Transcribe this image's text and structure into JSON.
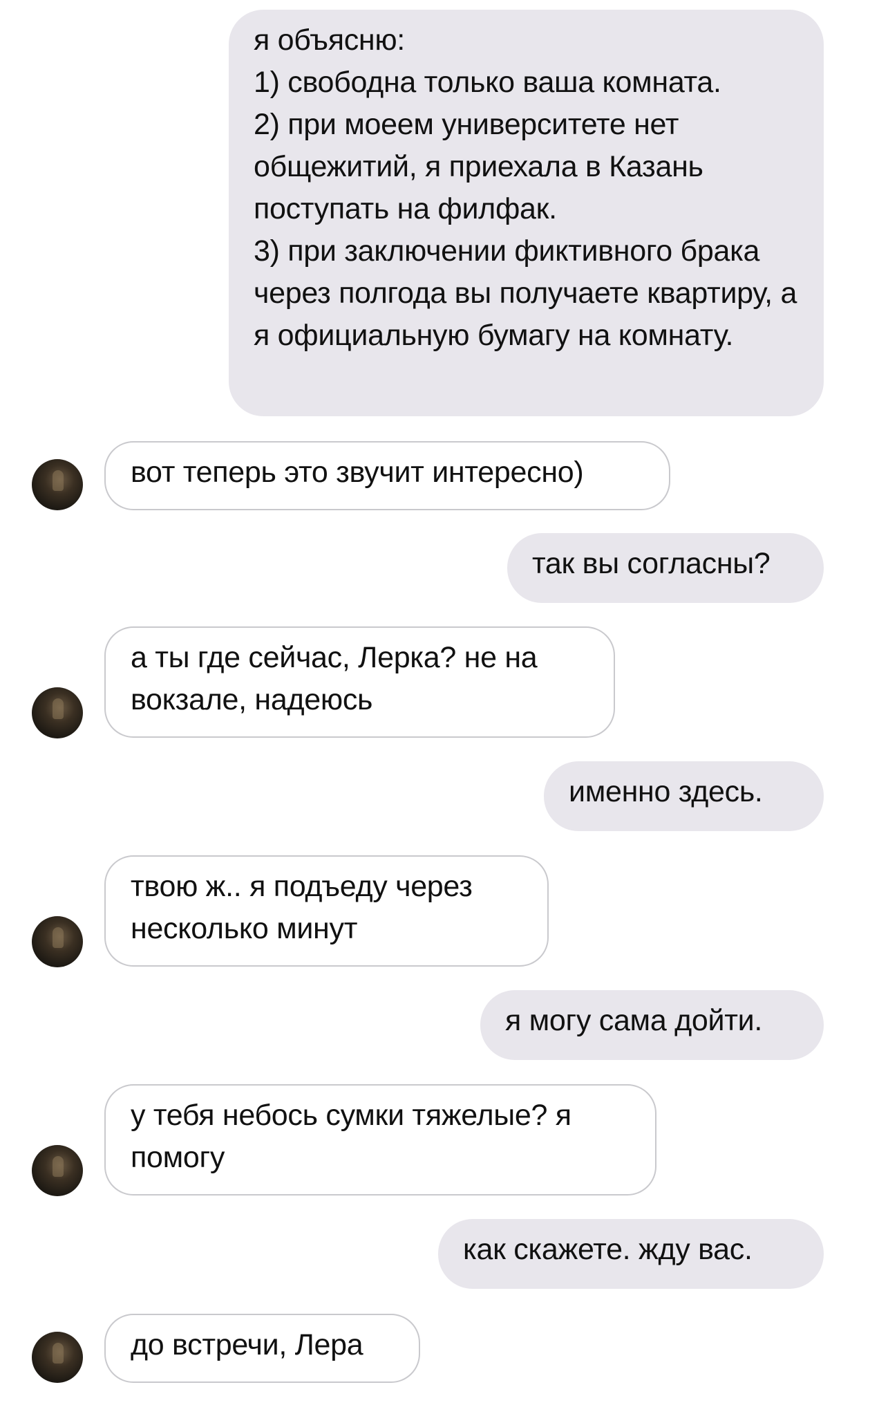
{
  "messages": [
    {
      "id": "m1",
      "side": "sent",
      "text": "я объясню:\n1) свободна только ваша комната.\n2) при моеем университете нет общежитий, я приехала в Казань поступать на филфак.\n3) при заключении фиктивного брака через полгода вы получаете квартиру, а я официальную бумагу на комнату."
    },
    {
      "id": "m2",
      "side": "received",
      "text": "вот теперь это звучит интересно)"
    },
    {
      "id": "m3",
      "side": "sent",
      "text": "так вы согласны?"
    },
    {
      "id": "m4",
      "side": "received",
      "text": "а ты где сейчас, Лерка? не на вокзале, надеюсь"
    },
    {
      "id": "m5",
      "side": "sent",
      "text": "именно здесь."
    },
    {
      "id": "m6",
      "side": "received",
      "text": "твою ж.. я подъеду через несколько минут"
    },
    {
      "id": "m7",
      "side": "sent",
      "text": "я могу сама дойти."
    },
    {
      "id": "m8",
      "side": "received",
      "text": "у тебя небось сумки тяжелые? я помогу"
    },
    {
      "id": "m9",
      "side": "sent",
      "text": "как скажете. жду вас."
    },
    {
      "id": "m10",
      "side": "received",
      "text": "до встречи, Лера"
    }
  ],
  "colors": {
    "sent_bubble": "#e8e6ec",
    "received_border": "#c9c9cd",
    "background": "#ffffff"
  }
}
